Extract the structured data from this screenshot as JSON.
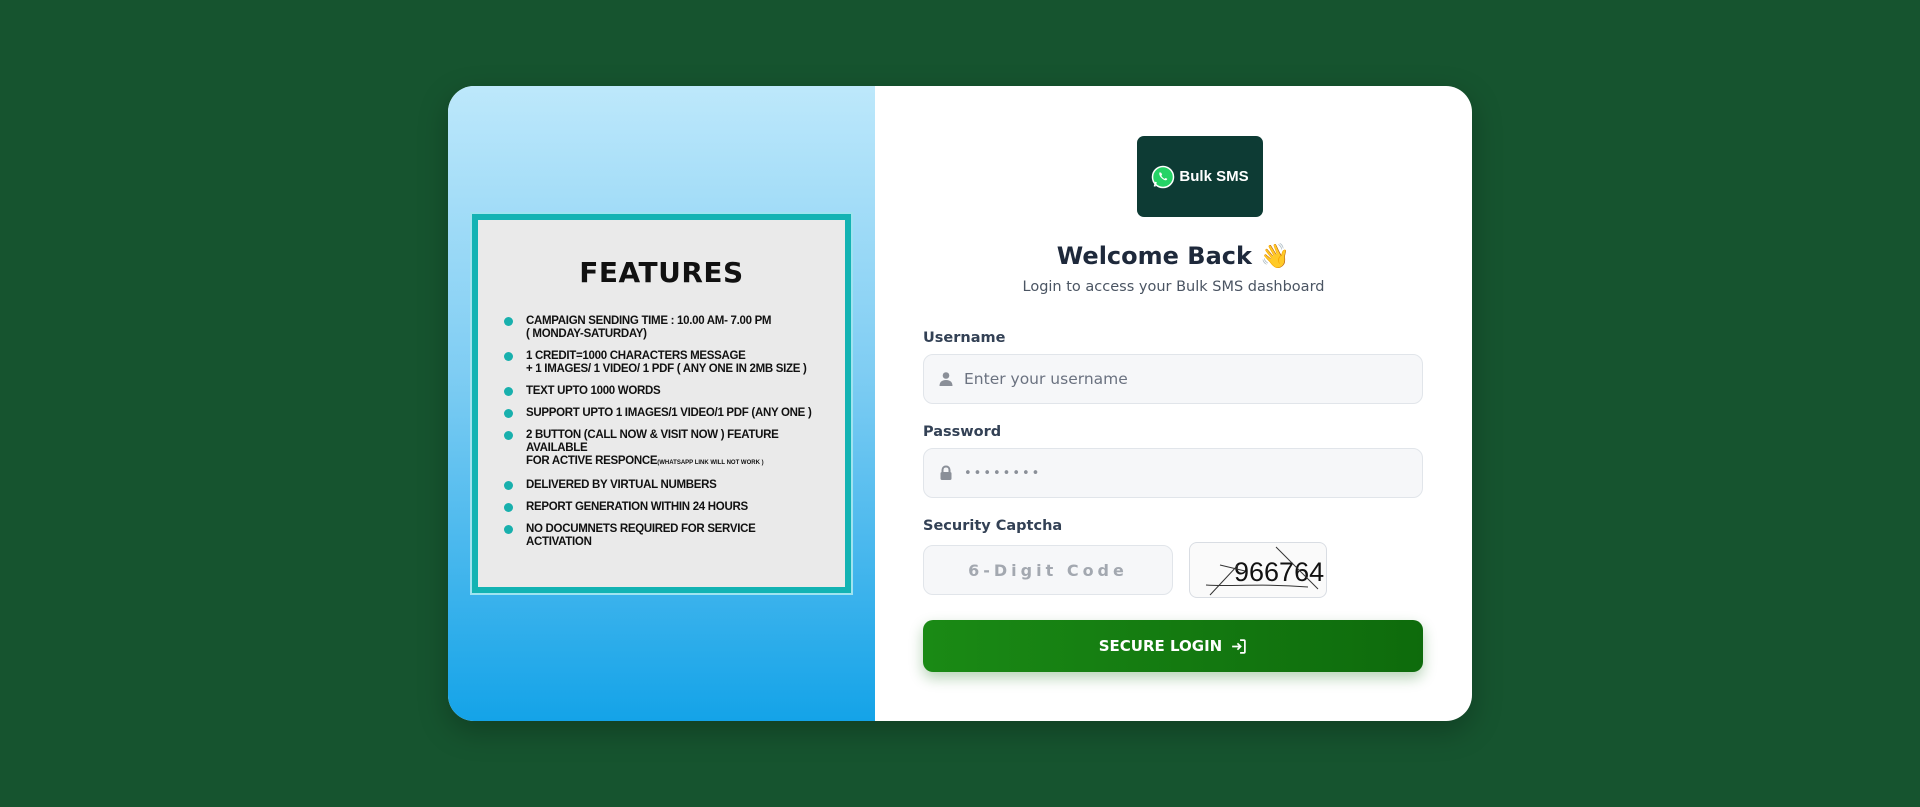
{
  "features": {
    "title": "FEATURES",
    "items": [
      {
        "line1": "CAMPAIGN SENDING TIME : 10.00 AM- 7.00 PM",
        "line2": "( MONDAY-SATURDAY)",
        "small": ""
      },
      {
        "line1": "1 CREDIT=1000 CHARACTERS MESSAGE",
        "line2": "+ 1 IMAGES/ 1 VIDEO/ 1 PDF ( ANY ONE IN 2MB SIZE )",
        "small": ""
      },
      {
        "line1": "TEXT UPTO 1000 WORDS",
        "line2": "",
        "small": ""
      },
      {
        "line1": "SUPPORT UPTO 1 IMAGES/1 VIDEO/1 PDF (ANY ONE )",
        "line2": "",
        "small": ""
      },
      {
        "line1": "2 BUTTON (CALL NOW & VISIT NOW ) FEATURE AVAILABLE",
        "line2": "FOR ACTIVE RESPONCE",
        "small": "(WHATSAPP LINK WILL NOT WORK )"
      },
      {
        "line1": "DELIVERED BY VIRTUAL NUMBERS",
        "line2": "",
        "small": ""
      },
      {
        "line1": "REPORT GENERATION WITHIN 24 HOURS",
        "line2": "",
        "small": ""
      },
      {
        "line1": "NO DOCUMNETS REQUIRED FOR SERVICE ACTIVATION",
        "line2": "",
        "small": ""
      }
    ]
  },
  "logo": {
    "text": "Bulk SMS",
    "icon": "whatsapp-icon",
    "bg_color": "#0d3b34"
  },
  "header": {
    "title": "Welcome Back 👋",
    "subtitle": "Login to access your Bulk SMS dashboard"
  },
  "form": {
    "username_label": "Username",
    "username_placeholder": "Enter your username",
    "username_icon": "user-icon",
    "password_label": "Password",
    "password_value": "••••••••",
    "password_icon": "lock-icon",
    "captcha_label": "Security Captcha",
    "captcha_placeholder": "6-Digit Code",
    "captcha_code": "966764",
    "login_label": "SECURE LOGIN",
    "login_icon": "sign-in-icon"
  },
  "colors": {
    "page_bg": "#16542f",
    "accent_green": "#1a8a15",
    "feature_bullet": "#18b0ad"
  }
}
